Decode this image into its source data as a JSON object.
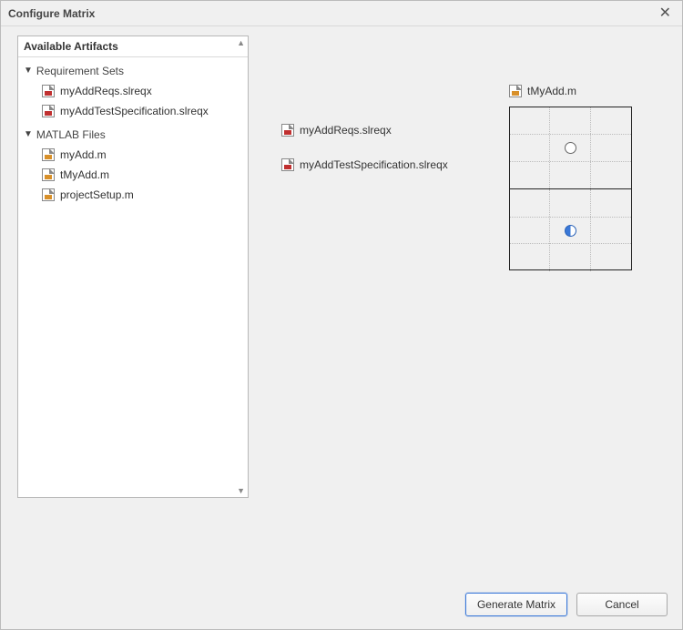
{
  "dialog": {
    "title": "Configure Matrix"
  },
  "panel": {
    "header": "Available Artifacts",
    "groups": [
      {
        "label": "Requirement Sets",
        "items": [
          {
            "label": "myAddReqs.slreqx",
            "icon": "slreqx"
          },
          {
            "label": "myAddTestSpecification.slreqx",
            "icon": "slreqx"
          }
        ]
      },
      {
        "label": "MATLAB Files",
        "items": [
          {
            "label": "myAdd.m",
            "icon": "m"
          },
          {
            "label": "tMyAdd.m",
            "icon": "m"
          },
          {
            "label": "projectSetup.m",
            "icon": "m"
          }
        ]
      }
    ]
  },
  "matrix": {
    "column": {
      "label": "tMyAdd.m",
      "icon": "m"
    },
    "rows": [
      {
        "label": "myAddReqs.slreqx",
        "icon": "slreqx",
        "link": "empty"
      },
      {
        "label": "myAddTestSpecification.slreqx",
        "icon": "slreqx",
        "link": "half"
      }
    ]
  },
  "buttons": {
    "generate": "Generate Matrix",
    "cancel": "Cancel"
  }
}
